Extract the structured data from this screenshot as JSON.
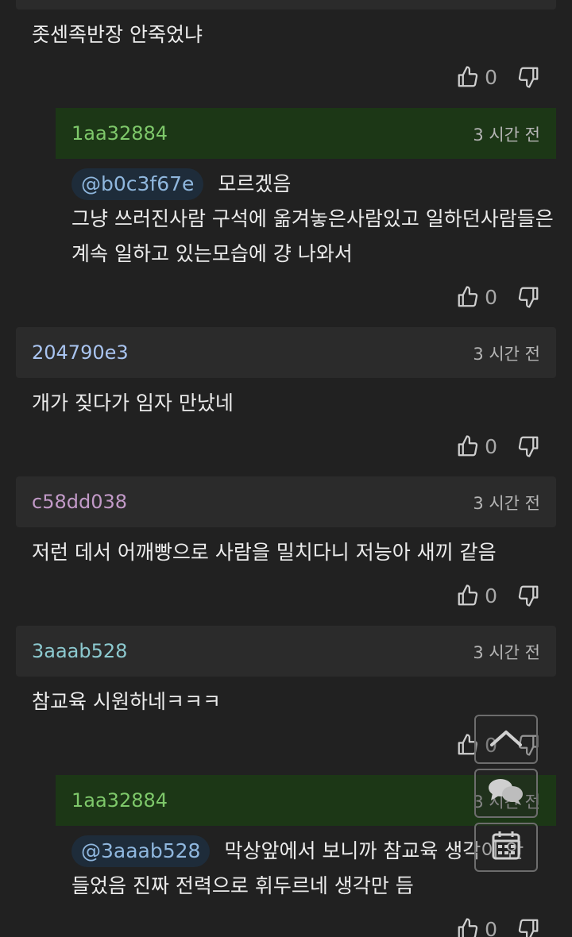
{
  "colors": {
    "background": "#212121",
    "header": "#2b2b2b",
    "reply_header": "#1c3716",
    "mention_bg": "#1e2c3a",
    "mention_text": "#8fb7de"
  },
  "comments": [
    {
      "text": "좃센족반장 안죽었냐",
      "likes": "0"
    },
    {
      "author": "1aa32884",
      "author_color": "#7ec86a",
      "time": "3 시간 전",
      "mention": "@b0c3f67e",
      "text_first": "모르겠음",
      "text_rest": "그냥 쓰러진사람 구석에 옮겨놓은사람있고 일하던사람들은 계속 일하고 있는모습에 걍 나와서",
      "likes": "0"
    },
    {
      "author": "204790e3",
      "author_color": "#a9c4f0",
      "time": "3 시간 전",
      "text": "개가 짖다가 임자 만났네",
      "likes": "0"
    },
    {
      "author": "c58dd038",
      "author_color": "#c29ac8",
      "time": "3 시간 전",
      "text": "저런 데서 어깨빵으로 사람을 밀치다니 저능아 새끼 같음",
      "likes": "0"
    },
    {
      "author": "3aaab528",
      "author_color": "#8cc9cf",
      "time": "3 시간 전",
      "text": "참교육 시원하네ㅋㅋㅋ",
      "likes": "0"
    },
    {
      "author": "1aa32884",
      "author_color": "#7ec86a",
      "time": "3 시간 전",
      "mention": "@3aaab528",
      "text_first": "막상앞에서 보니까 참교육 생각이 안",
      "text_rest": "들었음 진짜 전력으로 휘두르네 생각만 듬",
      "likes": "0"
    }
  ],
  "floating_buttons": [
    "scroll-top-icon",
    "comments-icon",
    "calendar-icon"
  ]
}
